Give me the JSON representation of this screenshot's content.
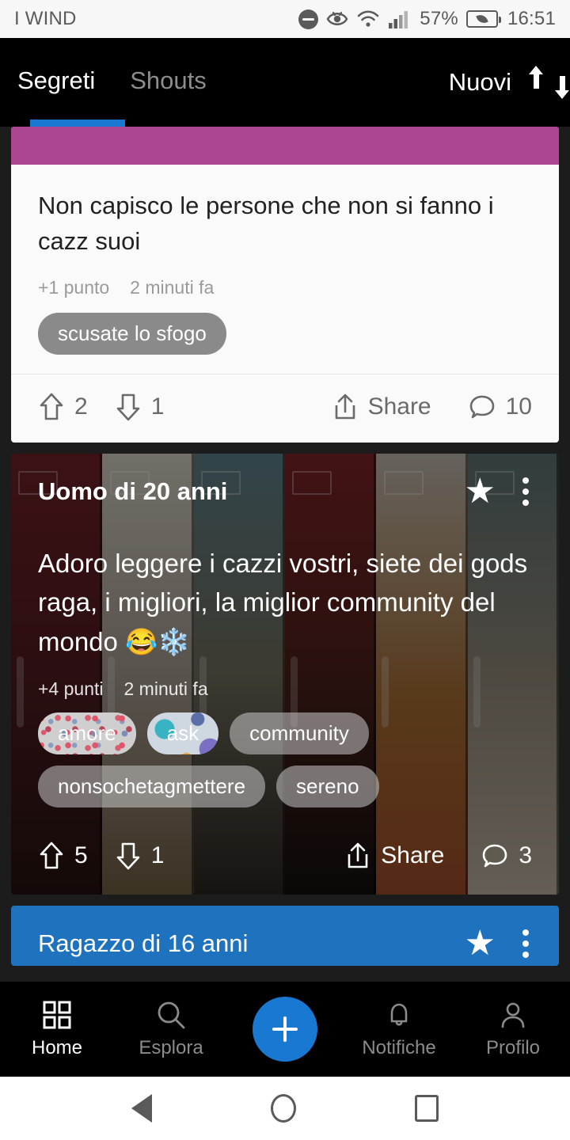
{
  "status_bar": {
    "carrier": "I WIND",
    "battery_percent": "57%",
    "time": "16:51",
    "icons": [
      "do-not-disturb-icon",
      "eye-comfort-icon",
      "wifi-icon",
      "signal-bars-icon",
      "battery-saver-icon"
    ]
  },
  "app_bar": {
    "tabs": [
      {
        "label": "Segreti",
        "active": true
      },
      {
        "label": "Shouts",
        "active": false
      }
    ],
    "sort_label": "Nuovi",
    "sort_icon": "sort-arrows-icon",
    "accent_color": "#1878d2"
  },
  "feed": {
    "posts": [
      {
        "id": "post-1",
        "cover_color": "#ae4593",
        "text": "Non capisco le persone che non si fanno i cazz suoi",
        "points": "+1 punto",
        "time": "2 minuti fa",
        "tags": [
          "scusate lo sfogo"
        ],
        "upvotes": "2",
        "downvotes": "1",
        "share_label": "Share",
        "comments": "10"
      },
      {
        "id": "post-2",
        "author": "Uomo di 20 anni",
        "text": "Adoro leggere i cazzi vostri, siete dei gods raga, i migliori, la miglior community del mondo 😂❄️",
        "points": "+4 punti",
        "time": "2 minuti fa",
        "tags": [
          "amore",
          "ask",
          "community",
          "nonsochetagmettere",
          "sereno"
        ],
        "upvotes": "5",
        "downvotes": "1",
        "share_label": "Share",
        "comments": "3",
        "starred": true
      },
      {
        "id": "post-3",
        "author": "Ragazzo di 16 anni",
        "cover_color": "#1f72bd",
        "starred": true
      }
    ]
  },
  "bottom_nav": {
    "items": [
      {
        "label": "Home",
        "icon": "grid-icon",
        "active": true
      },
      {
        "label": "Esplora",
        "icon": "search-icon",
        "active": false
      },
      {
        "label": "Notifiche",
        "icon": "bell-icon",
        "active": false
      },
      {
        "label": "Profilo",
        "icon": "person-icon",
        "active": false
      }
    ],
    "fab": {
      "icon": "plus-icon",
      "color": "#1878d2"
    }
  },
  "android_nav": {
    "back": "back-triangle-icon",
    "home": "home-circle-icon",
    "recents": "recents-square-icon"
  }
}
